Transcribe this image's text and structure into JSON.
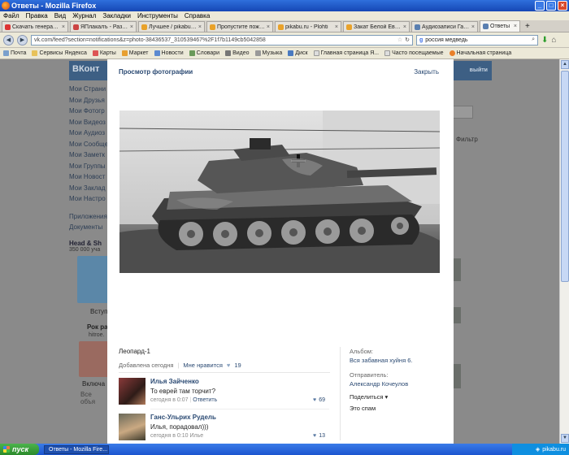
{
  "window": {
    "title": "Ответы - Mozilla Firefox"
  },
  "menu": [
    "Файл",
    "Правка",
    "Вид",
    "Журнал",
    "Закладки",
    "Инструменты",
    "Справка"
  ],
  "tabs": [
    {
      "label": "Скачать генератор ...",
      "color": "#d33"
    },
    {
      "label": "ЯПлакалъ - Раздел...",
      "color": "#c44"
    },
    {
      "label": "Лучшее / pikabu.ru - ...",
      "color": "#e9a22a"
    },
    {
      "label": "Пропустите пожалу...",
      "color": "#e9a22a"
    },
    {
      "label": "pikabu.ru - Plohti",
      "color": "#e9a22a"
    },
    {
      "label": "Закат Белой Европы.",
      "color": "#e9a22a"
    },
    {
      "label": "Аудиозаписи Ганса-...",
      "color": "#5a7fb0"
    },
    {
      "label": "Ответы",
      "color": "#5a7fb0",
      "active": true
    }
  ],
  "nav": {
    "url": "vk.com/feed?section=notifications&z=photo-38436537_310539467%2F1f7b1149cb5042858",
    "search": "россия медведь"
  },
  "bookmarks": [
    "Почта",
    "Сервисы Яндекса",
    "Карты",
    "Маркет",
    "Новости",
    "Словари",
    "Видео",
    "Музыка",
    "Диск",
    "Главная страница Я...",
    "Часто посещаемые",
    "Начальная страница"
  ],
  "vk": {
    "logo": "ВКонт",
    "exit": "выйти",
    "menu": [
      "Мои Страни",
      "Мои Друзья",
      "Мои Фотогр",
      "Мои Видеоз",
      "Мои Аудиоз",
      "Мои Сообще",
      "Мои Заметк",
      "Мои Группы",
      "Мои Новост",
      "Мои Заклад",
      "Мои Настро"
    ],
    "menu2": [
      "Приложения",
      "Документы"
    ],
    "group_title": "Head & Sh",
    "group_sub": "350 000 уча",
    "group_btn": "Вступ",
    "ad_title": "Рок ра",
    "ad_sub": "hitroe.",
    "ad_btn": "Включа",
    "misc": "Все объя",
    "right_text": "Фильтр"
  },
  "modal": {
    "title": "Просмотр фотографии",
    "close": "Закрыть",
    "caption": "Леопард-1",
    "added": "Добавлена сегодня",
    "like_label": "Мне нравится",
    "like_count": "19",
    "album_label": "Альбом:",
    "album_value": "Вся забавная хуйня 6.",
    "sender_label": "Отправитель:",
    "sender_value": "Александр Кочеулов",
    "share": "Поделиться",
    "spam": "Это спам"
  },
  "comments": [
    {
      "name": "Илья Зайченко",
      "text": "То еврей там торчит?",
      "time": "сегодня в 0:07",
      "reply": "Ответить",
      "likes": "69"
    },
    {
      "name": "Ганс-Ульрих Рудель",
      "text": "Илья, порадовал)))",
      "time": "сегодня в 0:10 Илье",
      "reply": "",
      "likes": "13"
    }
  ],
  "taskbar": {
    "start": "пуск",
    "task": "Ответы - Mozilla Fire...",
    "tray": "pikabu.ru"
  }
}
